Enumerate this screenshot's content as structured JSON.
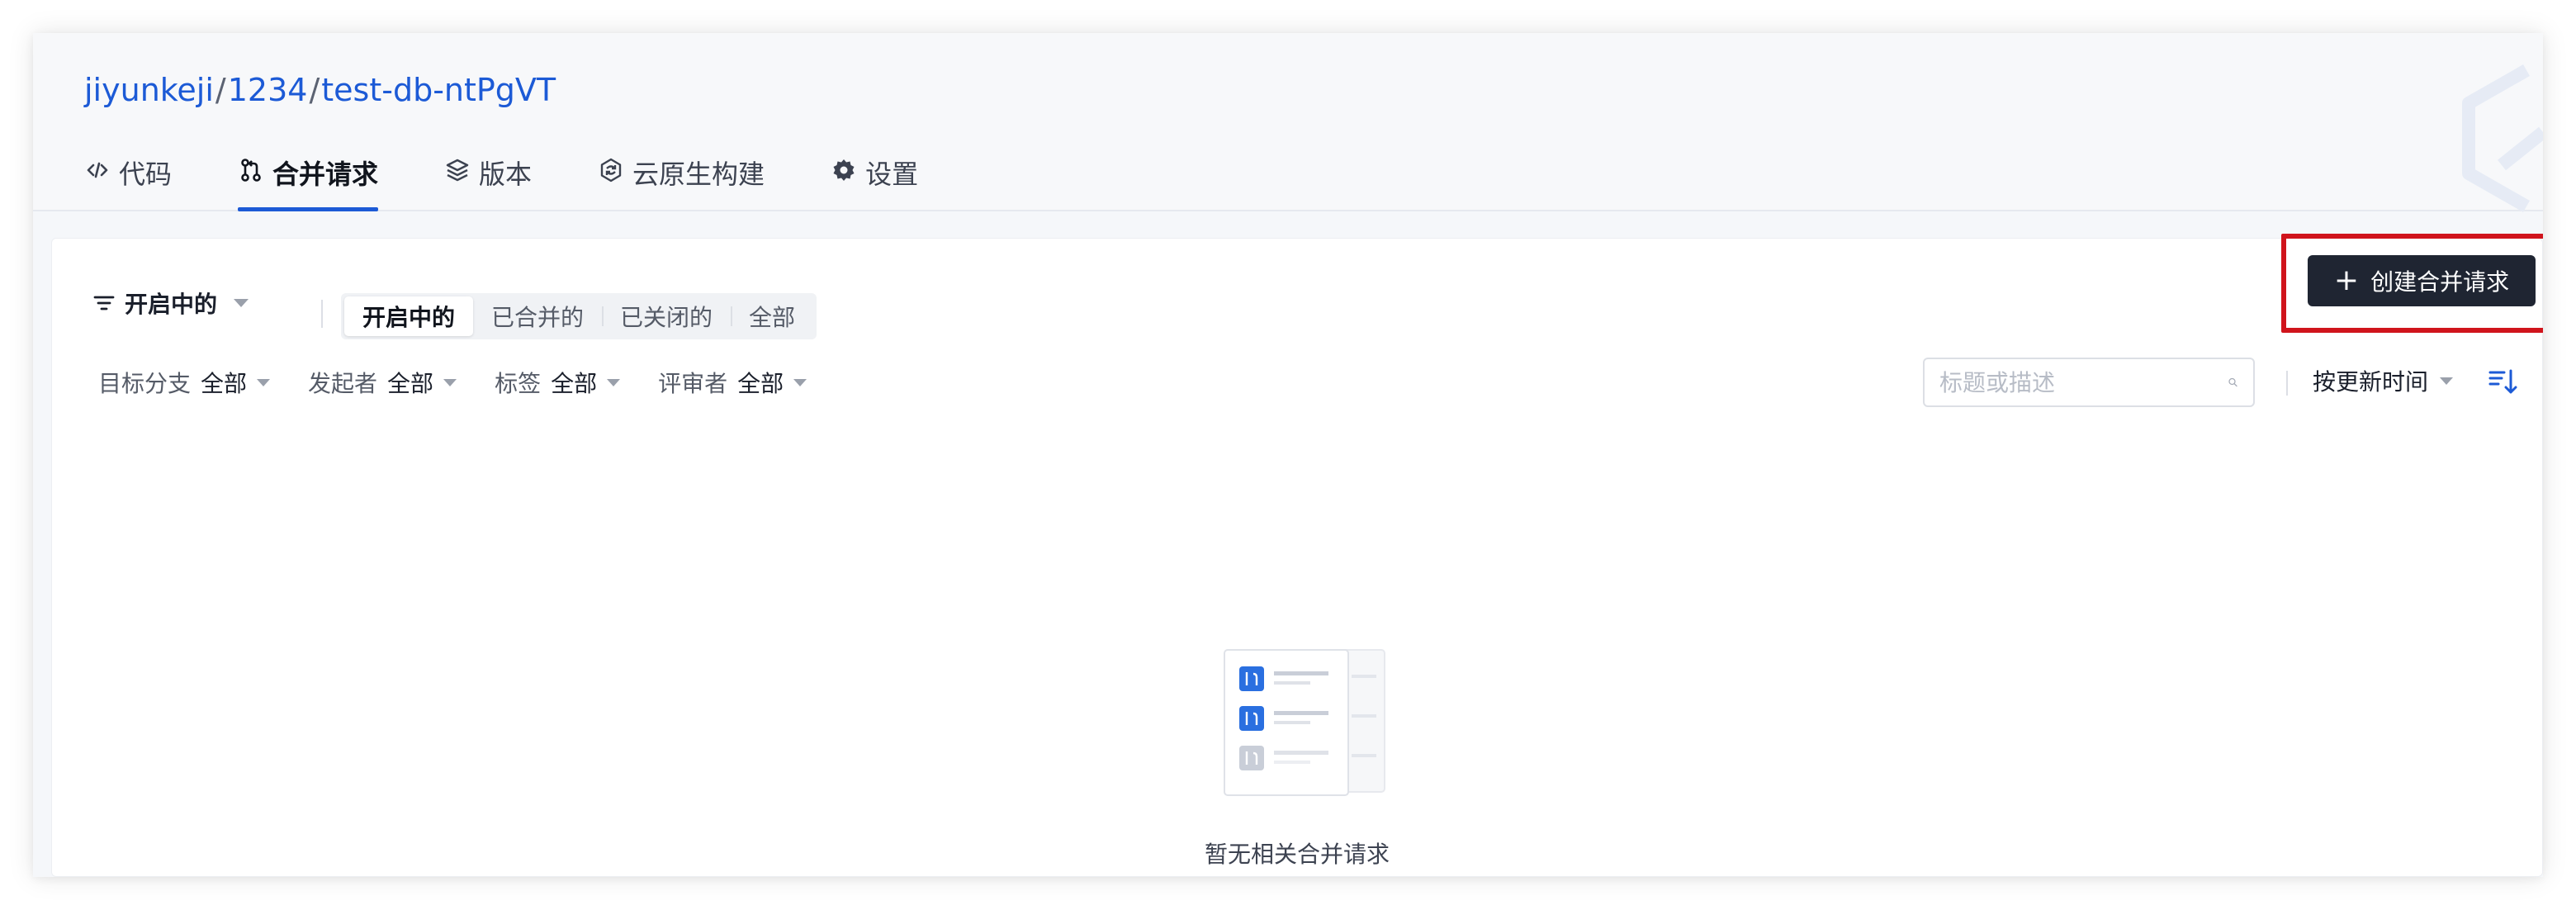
{
  "breadcrumb": {
    "org": "jiyunkeji",
    "group": "1234",
    "repo": "test-db-ntPgVT",
    "sep": "/"
  },
  "tabs": [
    {
      "label": "代码",
      "icon": "code-icon"
    },
    {
      "label": "合并请求",
      "icon": "merge-request-icon",
      "active": true
    },
    {
      "label": "版本",
      "icon": "layers-icon"
    },
    {
      "label": "云原生构建",
      "icon": "build-icon"
    },
    {
      "label": "设置",
      "icon": "gear-icon"
    }
  ],
  "filter_bar": {
    "state_dropdown": "开启中的",
    "segments": [
      "开启中的",
      "已合并的",
      "已关闭的",
      "全部"
    ],
    "filters": [
      {
        "label": "目标分支",
        "value": "全部"
      },
      {
        "label": "发起者",
        "value": "全部"
      },
      {
        "label": "标签",
        "value": "全部"
      },
      {
        "label": "评审者",
        "value": "全部"
      }
    ],
    "search_placeholder": "标题或描述",
    "sort_label": "按更新时间"
  },
  "create_button": {
    "plus": "+",
    "label": "创建合并请求"
  },
  "empty": {
    "text": "暂无相关合并请求"
  },
  "colors": {
    "accent": "#1c5ad6",
    "primary_button": "#1f2532",
    "highlight_box": "#d0141c"
  }
}
